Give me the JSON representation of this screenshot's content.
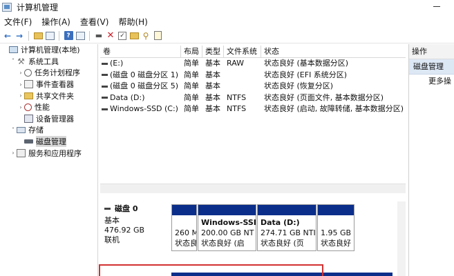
{
  "window": {
    "title": "计算机管理"
  },
  "menu": [
    "文件(F)",
    "操作(A)",
    "查看(V)",
    "帮助(H)"
  ],
  "tree": [
    {
      "label": "计算机管理(本地)",
      "indent": 0,
      "twisty": "",
      "icon": "computer-icon"
    },
    {
      "label": "系统工具",
      "indent": 1,
      "twisty": "v",
      "icon": "tools-icon"
    },
    {
      "label": "任务计划程序",
      "indent": 2,
      "twisty": ">",
      "icon": "clock-icon"
    },
    {
      "label": "事件查看器",
      "indent": 2,
      "twisty": ">",
      "icon": "event-log-icon"
    },
    {
      "label": "共享文件夹",
      "indent": 2,
      "twisty": ">",
      "icon": "folder-icon"
    },
    {
      "label": "性能",
      "indent": 2,
      "twisty": ">",
      "icon": "performance-icon"
    },
    {
      "label": "设备管理器",
      "indent": 2,
      "twisty": "",
      "icon": "device-icon"
    },
    {
      "label": "存储",
      "indent": 1,
      "twisty": "v",
      "icon": "storage-icon"
    },
    {
      "label": "磁盘管理",
      "indent": 2,
      "twisty": "",
      "icon": "disk-icon",
      "selected": true
    },
    {
      "label": "服务和应用程序",
      "indent": 1,
      "twisty": ">",
      "icon": "services-icon"
    }
  ],
  "columns": [
    "卷",
    "布局",
    "类型",
    "文件系统",
    "状态"
  ],
  "volumes": [
    [
      "(E:)",
      "简单",
      "基本",
      "RAW",
      "状态良好 (基本数据分区)"
    ],
    [
      "(磁盘 0 磁盘分区 1)",
      "简单",
      "基本",
      "",
      "状态良好 (EFI 系统分区)"
    ],
    [
      "(磁盘 0 磁盘分区 5)",
      "简单",
      "基本",
      "",
      "状态良好 (恢复分区)"
    ],
    [
      "Data (D:)",
      "简单",
      "基本",
      "NTFS",
      "状态良好 (页面文件, 基本数据分区)"
    ],
    [
      "Windows-SSD (C:)",
      "简单",
      "基本",
      "NTFS",
      "状态良好 (启动, 故障转储, 基本数据分区)"
    ]
  ],
  "disk0": {
    "name": "磁盘 0",
    "type": "基本",
    "size": "476.92 GB",
    "status": "联机",
    "partitions": [
      {
        "name": "",
        "size": "260 M",
        "status": "状态良"
      },
      {
        "name": "Windows-SSI",
        "size": "200.00 GB NT",
        "status": "状态良好 (启"
      },
      {
        "name": "Data  (D:)",
        "size": "274.71 GB NTI",
        "status": "状态良好 (页"
      },
      {
        "name": "",
        "size": "1.95 GB",
        "status": "状态良好"
      }
    ]
  },
  "actions": {
    "title": "操作",
    "section": "磁盘管理",
    "more": "更多操"
  }
}
